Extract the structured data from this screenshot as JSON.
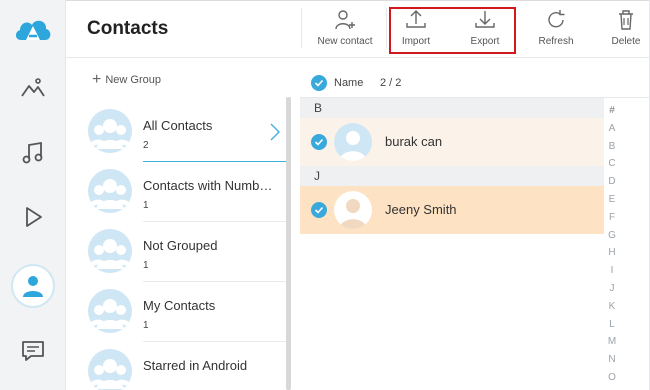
{
  "app": {
    "title": "Contacts"
  },
  "colors": {
    "accent": "#39a9dc",
    "highlight_border": "#d0191f",
    "selected_row": "#fde3c3",
    "hover_row": "#fbf3ea",
    "rail_bg": "#f2f3f5",
    "avatar_bg": "#cfe6f4"
  },
  "rail": {
    "items": [
      {
        "icon": "logo-icon"
      },
      {
        "icon": "photos-icon"
      },
      {
        "icon": "music-icon"
      },
      {
        "icon": "video-icon"
      },
      {
        "icon": "contacts-icon",
        "active": true
      },
      {
        "icon": "messages-icon"
      }
    ]
  },
  "toolbar": {
    "new_contact": "New contact",
    "import": "Import",
    "export": "Export",
    "refresh": "Refresh",
    "delete": "Delete"
  },
  "groups": {
    "new_group": "New Group",
    "items": [
      {
        "name": "All Contacts",
        "count": "2",
        "active": true
      },
      {
        "name": "Contacts with Numb…",
        "count": "1"
      },
      {
        "name": "Not Grouped",
        "count": "1"
      },
      {
        "name": "My Contacts",
        "count": "1"
      },
      {
        "name": "Starred in Android",
        "count": ""
      }
    ]
  },
  "list": {
    "header_label": "Name",
    "header_count": "2 / 2",
    "sections": [
      {
        "letter": "B",
        "contacts": [
          {
            "name": "burak can",
            "checked": true
          }
        ]
      },
      {
        "letter": "J",
        "contacts": [
          {
            "name": "Jeeny Smith",
            "checked": true,
            "selected": true
          }
        ]
      }
    ],
    "alphabet": [
      "#",
      "A",
      "B",
      "C",
      "D",
      "E",
      "F",
      "G",
      "H",
      "I",
      "J",
      "K",
      "L",
      "M",
      "N",
      "O"
    ]
  }
}
